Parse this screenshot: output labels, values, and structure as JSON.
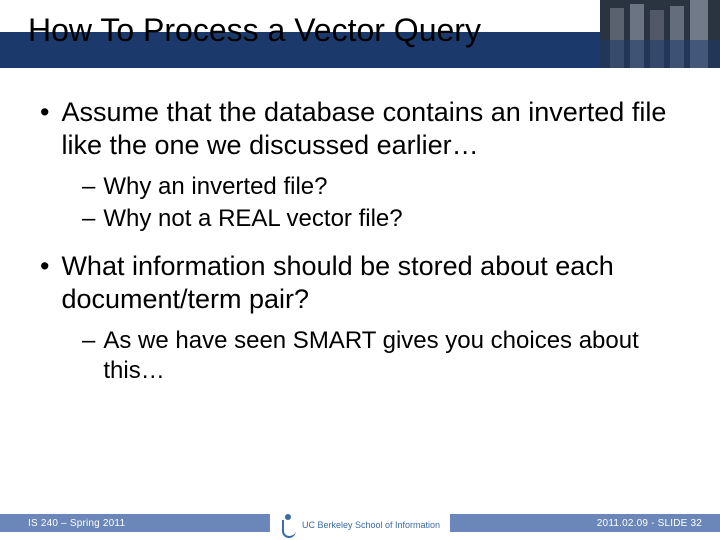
{
  "header": {
    "title": "How To Process a Vector Query"
  },
  "bullets": {
    "b0": "Assume that the database contains an inverted file like the one we discussed earlier…",
    "b0_0": "Why an inverted file?",
    "b0_1": "Why not a REAL vector file?",
    "b1": "What information should be stored about each document/term pair?",
    "b1_0": "As we have seen SMART gives you choices about this…"
  },
  "footer": {
    "left": "IS 240 – Spring 2011",
    "right": "2011.02.09 - SLIDE 32",
    "logo_text": "UC Berkeley School of Information"
  }
}
